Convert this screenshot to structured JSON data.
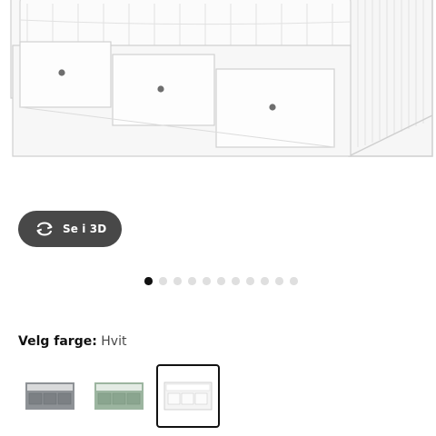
{
  "product_image": {
    "icon": "daybed-white-image"
  },
  "view_3d": {
    "label": "Se i 3D",
    "icon": "rotate-3d-icon"
  },
  "carousel": {
    "total": 11,
    "active_index": 0
  },
  "color_picker": {
    "label": "Velg farge:",
    "selected_value": "Hvit",
    "options": [
      {
        "name": "grey",
        "color": "#8e9296"
      },
      {
        "name": "green",
        "color": "#9cb5a0"
      },
      {
        "name": "white",
        "color": "#f4f4f4"
      }
    ],
    "selected_index": 2
  },
  "colors": {
    "button_bg": "#484848",
    "active_dot": "#111111",
    "inactive_dot": "#dfdfdf"
  }
}
